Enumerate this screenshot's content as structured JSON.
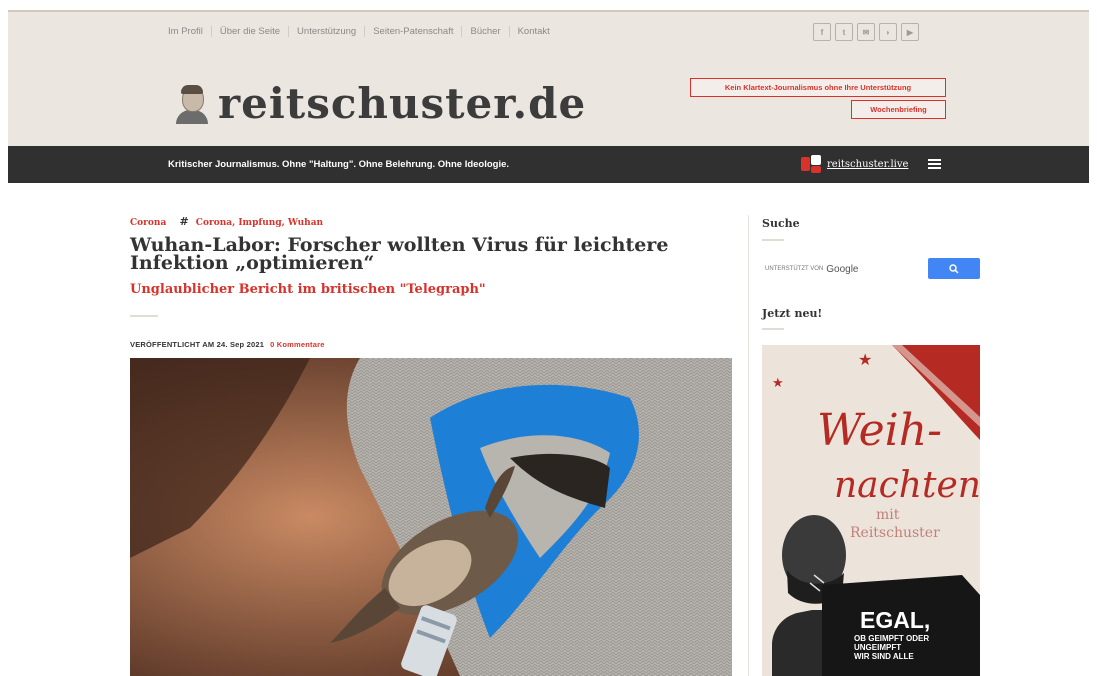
{
  "topnav": {
    "links": [
      "Im Profil",
      "Über die Seite",
      "Unterstützung",
      "Seiten-Patenschaft",
      "Bücher",
      "Kontakt"
    ],
    "social_icons": [
      "facebook-icon",
      "twitter-icon",
      "mail-icon",
      "rss-icon",
      "youtube-icon"
    ],
    "social_glyphs": [
      "f",
      "t",
      "✉",
      "◗",
      "▶"
    ]
  },
  "header": {
    "site_title": "reitschuster.de",
    "support_button": "Kein Klartext-Journalismus ohne Ihre Unterstützung",
    "briefing_button": "Wochenbriefing"
  },
  "bar": {
    "tagline": "Kritischer Journalismus. Ohne \"Haltung\". Ohne Belehrung. Ohne Ideologie.",
    "live_link": "reitschuster.live"
  },
  "article": {
    "category": "Corona",
    "tags": "Corona, Impfung, Wuhan",
    "headline": "Wuhan-Labor: Forscher wollten Virus für leichtere Infektion „optimieren“",
    "subheadline": "Unglaublicher Bericht im britischen \"Telegraph\"",
    "published": "VERÖFFENTLICHT AM 24. Sep 2021",
    "comments": "0 Kommentare"
  },
  "sidebar": {
    "search_heading": "Suche",
    "powered_by": "UNTERSTÜTZT VON",
    "google": "Google",
    "new_heading": "Jetzt neu!",
    "ad": {
      "line1": "Weih-",
      "line2": "nachten",
      "line3": "mit",
      "line4": "Reitschuster",
      "shirt_big": "EGAL,",
      "shirt_small1": "OB GEIMPFT ODER",
      "shirt_small2": "UNGEIMPFT",
      "shirt_small3": "WIR SIND ALLE"
    }
  },
  "colors": {
    "accent": "#d9322b",
    "bg_header": "#ebe6df",
    "bar": "#303030"
  }
}
